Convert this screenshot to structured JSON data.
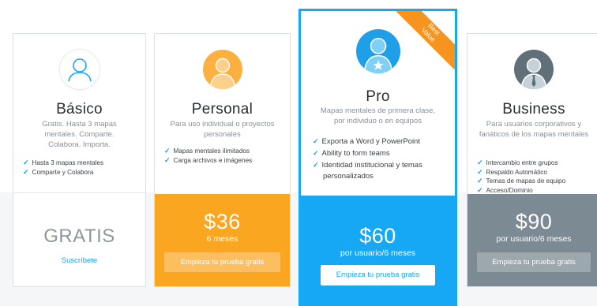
{
  "plans": [
    {
      "name": "Básico",
      "description": "Gratis. Hasta 3 mapas mentales. Comparte. Colabora. Importa.",
      "features": [
        "Hasta 3 mapas mentales",
        "Comparte y Colabora"
      ],
      "price": "GRATIS",
      "link": "Suscríbete",
      "avatar_icon": "user-outline-icon"
    },
    {
      "name": "Personal",
      "description": "Para uso individual o proyectos personales",
      "features": [
        "Mapas mentales ilimitados",
        "Carga archivos e imágenes"
      ],
      "price": "$36",
      "period": "6 meses",
      "button": "Empieza tu prueba gratis",
      "avatar_icon": "user-orange-icon"
    },
    {
      "name": "Pro",
      "description": "Mapas mentales de primera clase, por individuo o en equipos",
      "features": [
        "Exporta a Word y PowerPoint",
        "Ability to form teams",
        "Identidad institucional y temas",
        "personalizados"
      ],
      "price": "$60",
      "period": "por usuario/6 meses",
      "button": "Empieza tu prueba gratis",
      "ribbon": [
        "Best",
        "Value"
      ],
      "avatar_icon": "user-star-icon"
    },
    {
      "name": "Business",
      "description": "Para usuarios corporativos y fanáticos de los mapas mentales",
      "features": [
        "Intercambio entre grupos",
        "Respaldo Automático",
        "Temas de mapas de equipo",
        "Acceso/Dominio"
      ],
      "price": "$90",
      "period": "por usuario/6 meses",
      "button": "Empieza tu prueba gratis",
      "avatar_icon": "user-tie-icon"
    }
  ],
  "colors": {
    "accent_blue": "#16a7f5",
    "orange": "#fba620",
    "slate": "#7c8a93",
    "check": "#16a0f0"
  }
}
